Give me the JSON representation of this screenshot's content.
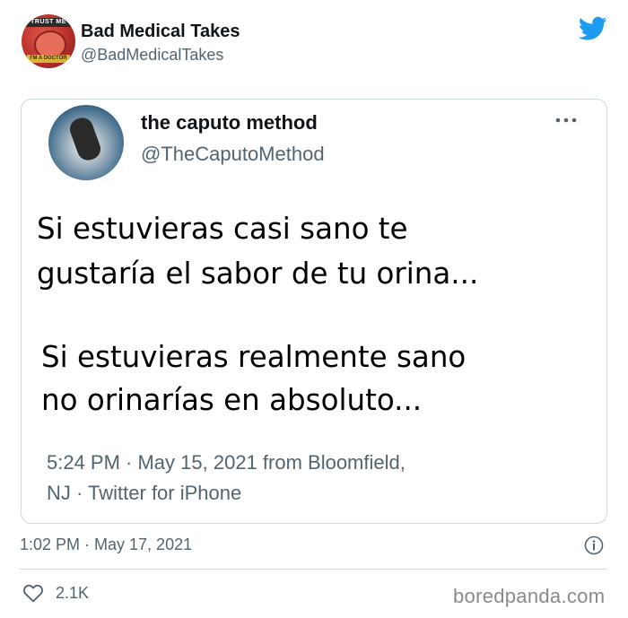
{
  "tweet": {
    "author_name": "Bad Medical Takes",
    "author_handle": "@BadMedicalTakes",
    "avatar_text_top": "TRUST ME",
    "avatar_text_bottom": "I'M A DOCTOR",
    "timestamp": "1:02 PM · May 17, 2021",
    "likes": "2.1K"
  },
  "quoted": {
    "author_name": "the caputo method",
    "author_handle": "@TheCaputoMethod",
    "lines": [
      "Si estuvieras casi sano te",
      "gustaría el sabor de tu orina...",
      "Si estuvieras realmente sano",
      "no orinarías en absoluto..."
    ],
    "meta_line_1": "5:24 PM · May 15, 2021 from Bloomfield,",
    "meta_line_2": "NJ · Twitter for iPhone"
  },
  "watermark": "boredpanda.com",
  "icons": {
    "brand": "twitter-bird-icon",
    "more": "more-options-icon",
    "info": "info-icon",
    "like": "heart-icon"
  },
  "colors": {
    "twitter_blue": "#1d9bf0",
    "secondary_text": "#536471",
    "border": "#cfd9de"
  }
}
